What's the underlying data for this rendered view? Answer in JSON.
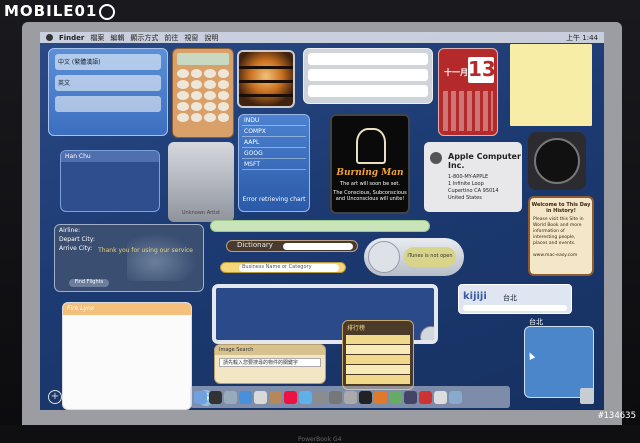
{
  "brand": {
    "logo_text": "MOBILE01"
  },
  "watermark": "#134635",
  "menubar": {
    "app": "Finder",
    "items": [
      "檔案",
      "編輯",
      "顯示方式",
      "前往",
      "視窗",
      "說明"
    ],
    "clock": "上午 1:44"
  },
  "widgets": {
    "world_clock": {
      "row1": "中文 (繁體漢語)",
      "row2": "英文"
    },
    "stocks": {
      "items": [
        "INDU",
        "COMPX",
        "AAPL",
        "GOOG",
        "MSFT"
      ],
      "error": "Error retrieving chart"
    },
    "calendar": {
      "month": "十一月",
      "day": "13",
      "weekday": "日"
    },
    "burning_man": {
      "title": "Burning Man",
      "subtitle": "The art will soon be set.",
      "body": "The Conscious, Subconscious and Unconscious will unite!"
    },
    "address_card": {
      "name": "Apple Computer Inc.",
      "phone": "1-800-MY-APPLE",
      "street": "1 Infinite Loop",
      "city": "Cupertino CA 95014",
      "country": "United States"
    },
    "history": {
      "title": "Welcome to This Day in History!",
      "body": "Please visit this Site in World Book and more information of interesting people, places and events.",
      "link": "www.mac-easy.com"
    },
    "chat": {
      "header": "Han Chu"
    },
    "gray_widget": {
      "label": "Unknown Artist"
    },
    "flight": {
      "fields": [
        "Airline:",
        "Depart City:",
        "Arrive City:"
      ],
      "banner": "Thank you for using our service",
      "button": "Find Flights"
    },
    "dictionary": {
      "title": "Dictionary"
    },
    "itunes": {
      "display": "iTunes is not open"
    },
    "yellow_pages": {
      "placeholder": "Business Name or Category"
    },
    "kijiji": {
      "logo": "kijiji",
      "city": "台北"
    },
    "stickies": {
      "header": "Fire Lynx"
    },
    "image_search": {
      "header": "Image Search",
      "input": "請先輸入您要搜尋的物件的關鍵字"
    },
    "list_widget": {
      "header": "排行榜"
    },
    "weather": {
      "city": "台北"
    }
  },
  "dock": {
    "left_icon": "S"
  },
  "laptop_label": "PowerBook G4"
}
